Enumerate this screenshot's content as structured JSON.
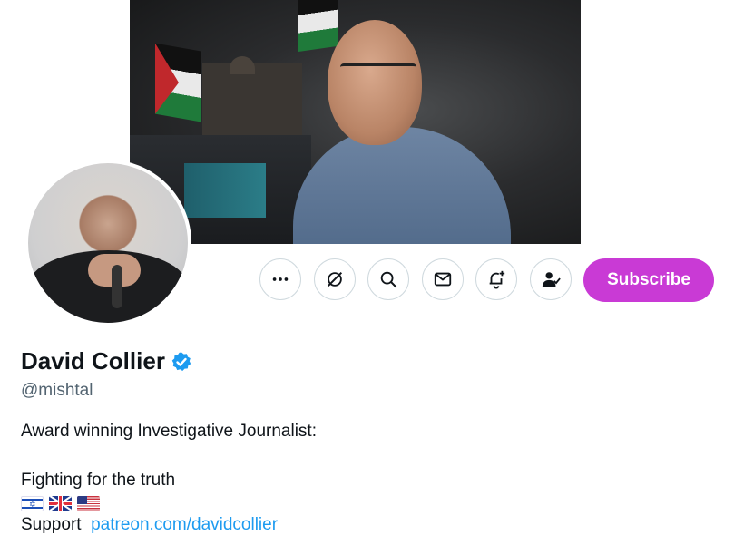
{
  "profile": {
    "name": "David Collier",
    "handle": "@mishtal",
    "bio_line1": "Award winning Investigative Journalist:",
    "bio_line2": "Fighting for the truth",
    "support_label": "Support",
    "support_link": "patreon.com/davidcollier",
    "flags": [
      "israel-flag",
      "uk-flag",
      "us-flag"
    ],
    "verified": true
  },
  "actions": {
    "buttons": [
      "more-icon",
      "grok-icon",
      "search-icon",
      "message-icon",
      "notification-add-icon",
      "following-icon"
    ],
    "subscribe_label": "Subscribe"
  },
  "colors": {
    "subscribe": "#c93ad5",
    "link": "#1d9bf0",
    "verified": "#1d9bf0",
    "muted": "#536471"
  }
}
